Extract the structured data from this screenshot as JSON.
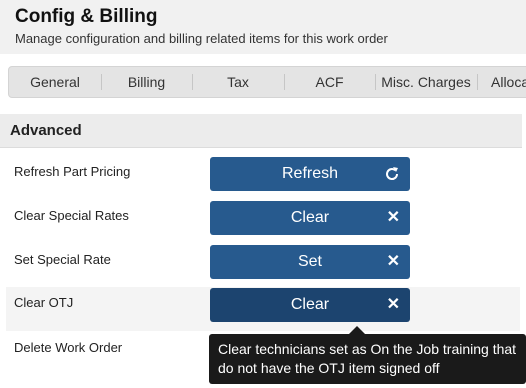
{
  "header": {
    "title": "Config & Billing",
    "subtitle": "Manage configuration and billing related items for this work order"
  },
  "tabs": [
    {
      "label": "General"
    },
    {
      "label": "Billing"
    },
    {
      "label": "Tax"
    },
    {
      "label": "ACF"
    },
    {
      "label": "Misc. Charges"
    },
    {
      "label": "Alloca"
    }
  ],
  "panel": {
    "title": "Advanced",
    "rows": [
      {
        "label": "Refresh Part Pricing",
        "button": "Refresh",
        "icon": "refresh-icon"
      },
      {
        "label": "Clear Special Rates",
        "button": "Clear",
        "icon": "close-icon"
      },
      {
        "label": "Set Special Rate",
        "button": "Set",
        "icon": "close-icon"
      },
      {
        "label": "Clear OTJ",
        "button": "Clear",
        "icon": "close-icon"
      },
      {
        "label": "Delete Work Order"
      }
    ]
  },
  "tooltip": {
    "text": "Clear technicians set as On the Job training that do not have the OTJ item signed off"
  },
  "colors": {
    "button": "#275a8e",
    "button_hover": "#1c446f",
    "tooltip_bg": "#1a1a1a"
  }
}
